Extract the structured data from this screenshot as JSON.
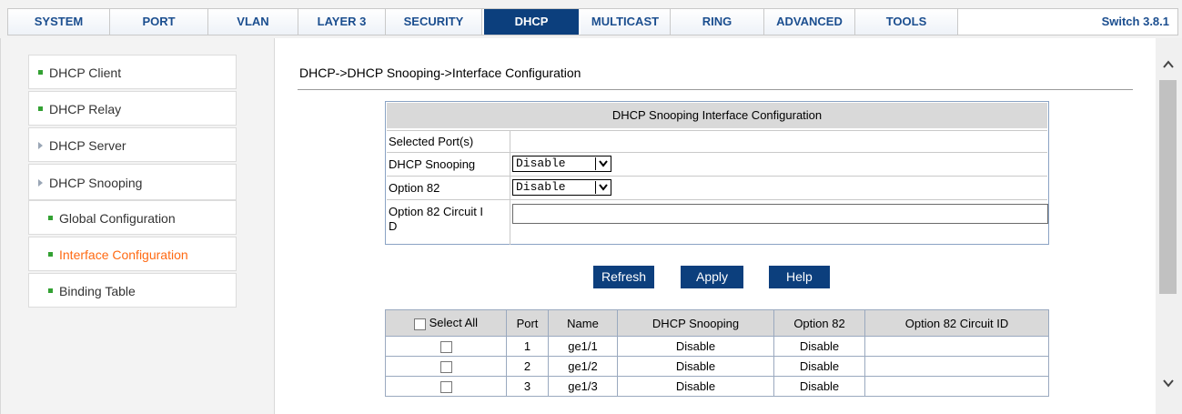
{
  "nav": {
    "tabs": [
      {
        "label": "SYSTEM"
      },
      {
        "label": "PORT"
      },
      {
        "label": "VLAN"
      },
      {
        "label": "LAYER 3"
      },
      {
        "label": "SECURITY"
      },
      {
        "label": "DHCP"
      },
      {
        "label": "MULTICAST"
      },
      {
        "label": "RING"
      },
      {
        "label": "ADVANCED"
      },
      {
        "label": "TOOLS"
      }
    ],
    "active_tab": "DHCP",
    "version": "Switch 3.8.1"
  },
  "sidebar": {
    "items": [
      {
        "label": "DHCP Client"
      },
      {
        "label": "DHCP Relay"
      },
      {
        "label": "DHCP Server"
      },
      {
        "label": "DHCP Snooping"
      },
      {
        "label": "Global Configuration"
      },
      {
        "label": "Interface Configuration"
      },
      {
        "label": "Binding Table"
      }
    ],
    "current": "Interface Configuration"
  },
  "main": {
    "breadcrumb": "DHCP->DHCP Snooping->Interface Configuration",
    "config": {
      "title": "DHCP Snooping Interface Configuration",
      "selected_ports_label": "Selected Port(s)",
      "selected_ports_value": "",
      "snooping_label": "DHCP Snooping",
      "snooping_value": "Disable",
      "option82_label": "Option 82",
      "option82_value": "Disable",
      "circuit_label_line1": "Option 82 Circuit I",
      "circuit_label_line2": "D",
      "circuit_value": ""
    },
    "buttons": {
      "refresh": "Refresh",
      "apply": "Apply",
      "help": "Help"
    },
    "table": {
      "select_all": "Select All",
      "headers": [
        "Port",
        "Name",
        "DHCP Snooping",
        "Option 82",
        "Option 82 Circuit ID"
      ],
      "rows": [
        {
          "port": "1",
          "name": "ge1/1",
          "snooping": "Disable",
          "option82": "Disable",
          "circuit": ""
        },
        {
          "port": "2",
          "name": "ge1/2",
          "snooping": "Disable",
          "option82": "Disable",
          "circuit": ""
        },
        {
          "port": "3",
          "name": "ge1/3",
          "snooping": "Disable",
          "option82": "Disable",
          "circuit": ""
        }
      ]
    }
  },
  "colors": {
    "nav_active_bg": "#0c3f7d",
    "nav_text": "#1b4e8f",
    "current_item": "#ff6a13",
    "bullet_green": "#33a133"
  }
}
